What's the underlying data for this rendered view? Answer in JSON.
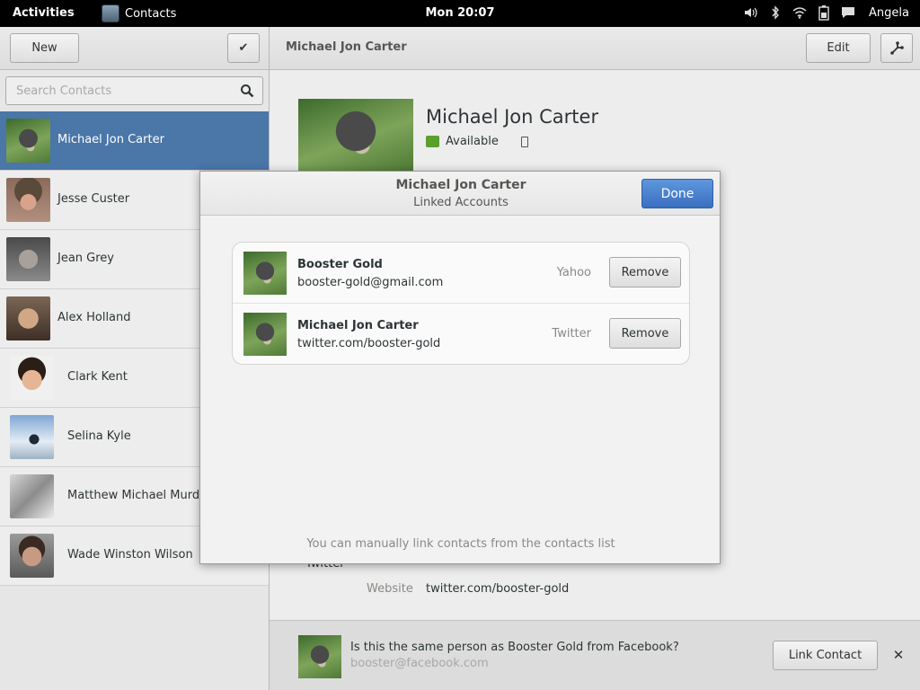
{
  "topbar": {
    "activities": "Activities",
    "app_name": "Contacts",
    "clock": "Mon 20:07",
    "user": "Angela",
    "tray_icons": [
      "volume-icon",
      "bluetooth-icon",
      "wifi-icon",
      "battery-icon",
      "chat-icon"
    ]
  },
  "left": {
    "new_label": "New",
    "select_glyph": "✔",
    "search_placeholder": "Search Contacts",
    "contacts": [
      {
        "name": "Michael Jon Carter",
        "selected": true
      },
      {
        "name": "Jesse Custer"
      },
      {
        "name": "Jean Grey"
      },
      {
        "name": "Alex Holland"
      },
      {
        "name": "Clark Kent"
      },
      {
        "name": "Selina Kyle"
      },
      {
        "name": "Matthew Michael Murdock"
      },
      {
        "name": "Wade Winston Wilson"
      }
    ]
  },
  "right": {
    "title": "Michael Jon Carter",
    "edit_label": "Edit",
    "detail_name": "Michael Jon Carter",
    "presence": "Available",
    "twitter_label": "Twitter",
    "website_label": "Website",
    "website_value": "twitter.com/booster-gold",
    "suggestion": {
      "question": "Is this the same person as Booster Gold from Facebook?",
      "email": "booster@facebook.com",
      "link_label": "Link Contact",
      "close_glyph": "✕"
    }
  },
  "dialog": {
    "title": "Michael Jon Carter",
    "subtitle": "Linked Accounts",
    "done_label": "Done",
    "accounts": [
      {
        "name": "Booster Gold",
        "id": "booster-gold@gmail.com",
        "service": "Yahoo",
        "remove_label": "Remove"
      },
      {
        "name": "Michael Jon Carter",
        "id": "twitter.com/booster-gold",
        "service": "Twitter",
        "remove_label": "Remove"
      }
    ],
    "hint": "You can manually link contacts from the contacts list"
  },
  "colors": {
    "selection": "#4a76a8",
    "done_button": "#3a6fc0",
    "presence_available": "#5aa02c"
  }
}
